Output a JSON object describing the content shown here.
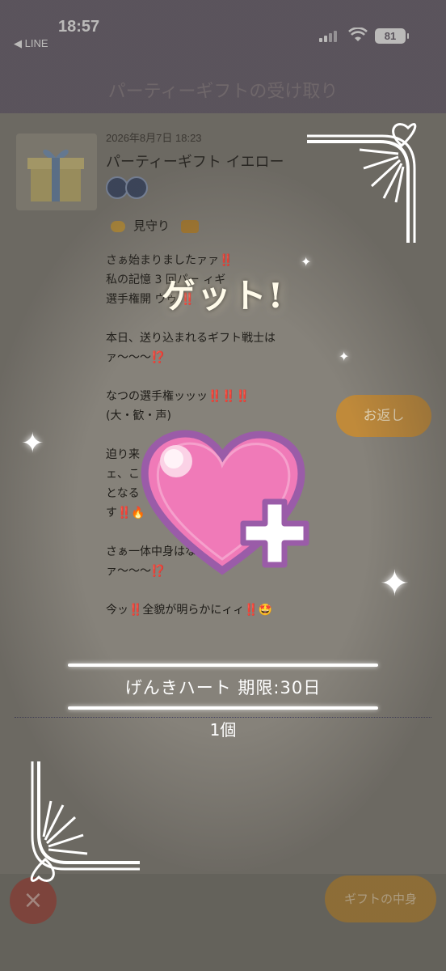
{
  "status": {
    "time": "18:57",
    "back_app": "◀ LINE",
    "battery": "81"
  },
  "header": {
    "title": "パーティーギフトの受け取り"
  },
  "message": {
    "date": "2026年8月7日 18:23",
    "gift_title": "パーティーギフト イエロー",
    "watch_label": "見守り",
    "body": "さぁ始まりましたァァ‼️\n私の記憶 3 回パー ィギ\n選手権開 ウゥ ‼️\n\n本日、送り込まれるギフト戦士は\nァ〜〜〜⁉️\n\nなつの選手権ッッッ‼️‼️‼️\n(大・歓・声)\n\n迫り来\nェ、こ\nとなる\nす‼️🔥\n\nさぁ一体中身はなんだァァ\nァ〜〜〜⁉️\n\n今ッ‼️全貌が明らかにィィ‼️🤩"
  },
  "buttons": {
    "return_label": "お返し",
    "close_icon": "×",
    "gift_contents_label": "ギフトの中身"
  },
  "overlay": {
    "get_label": "ゲット!",
    "item_name": "げんきハート 期限:30日",
    "item_quantity": "1個"
  }
}
